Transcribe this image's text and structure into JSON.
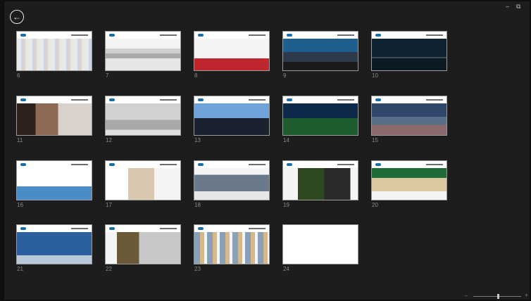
{
  "window": {
    "back_glyph": "←",
    "min_glyph": "–",
    "restore_glyph": "⧉"
  },
  "slides": [
    {
      "number": "6",
      "theme": "logo-wall",
      "color": "#e9e9e9"
    },
    {
      "number": "7",
      "theme": "monument",
      "color": "#d8d8d8"
    },
    {
      "number": "8",
      "theme": "devices-red",
      "color": "#c0262d"
    },
    {
      "number": "9",
      "theme": "crowd-blue",
      "color": "#1d5f8e"
    },
    {
      "number": "10",
      "theme": "stage-dark",
      "color": "#0f2230"
    },
    {
      "number": "11",
      "theme": "people",
      "color": "#6b4a3a"
    },
    {
      "number": "12",
      "theme": "hand-device",
      "color": "#bdbdbd"
    },
    {
      "number": "13",
      "theme": "silhouettes",
      "color": "#3d77b8"
    },
    {
      "number": "14",
      "theme": "stadium-green",
      "color": "#1e5c2f"
    },
    {
      "number": "15",
      "theme": "stadium-crowd",
      "color": "#30466a"
    },
    {
      "number": "16",
      "theme": "web-car",
      "color": "#4a8cc8"
    },
    {
      "number": "17",
      "theme": "web-pages",
      "color": "#d8c8b0"
    },
    {
      "number": "18",
      "theme": "laptop-web",
      "color": "#cfcfcf"
    },
    {
      "number": "19",
      "theme": "laptop-dark",
      "color": "#2a2a2a"
    },
    {
      "number": "20",
      "theme": "green-site",
      "color": "#1f6b3a"
    },
    {
      "number": "21",
      "theme": "tv-screens",
      "color": "#2c5fa0"
    },
    {
      "number": "22",
      "theme": "tunnel",
      "color": "#9a8a6a"
    },
    {
      "number": "23",
      "theme": "collage",
      "color": "#6a8aa8"
    },
    {
      "number": "24",
      "theme": "contact",
      "color": "#ffffff"
    }
  ],
  "zoom": {
    "minus_glyph": "–",
    "plus_glyph": "+",
    "level": 0.52
  }
}
